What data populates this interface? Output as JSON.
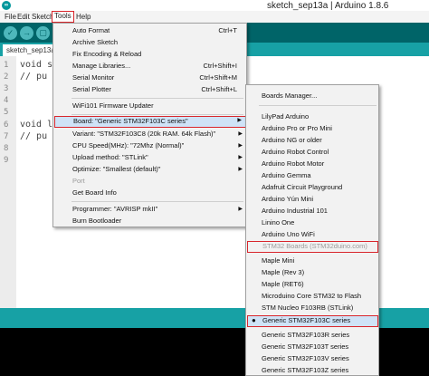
{
  "window": {
    "title": "sketch_sep13a | Arduino 1.8.6",
    "icon_text": "∞"
  },
  "menubar": [
    "File",
    "Edit",
    "Sketch",
    "Tools",
    "Help"
  ],
  "toolbar": {
    "buttons": [
      "✓",
      "→",
      "▢",
      "↑",
      "↓"
    ]
  },
  "tab": {
    "label": "sketch_sep13a"
  },
  "editor": {
    "lines": [
      {
        "num": "1",
        "text": "void se"
      },
      {
        "num": "2",
        "text": "  // pu"
      },
      {
        "num": "3",
        "text": ""
      },
      {
        "num": "4",
        "text": ""
      },
      {
        "num": "5",
        "text": ""
      },
      {
        "num": "6",
        "text": "void lo"
      },
      {
        "num": "7",
        "text": "  // pu"
      },
      {
        "num": "8",
        "text": ""
      },
      {
        "num": "9",
        "text": ""
      }
    ]
  },
  "tools_menu": {
    "items": [
      {
        "label": "Auto Format",
        "shortcut": "Ctrl+T"
      },
      {
        "label": "Archive Sketch",
        "shortcut": ""
      },
      {
        "label": "Fix Encoding & Reload",
        "shortcut": ""
      },
      {
        "label": "Manage Libraries...",
        "shortcut": "Ctrl+Shift+I"
      },
      {
        "label": "Serial Monitor",
        "shortcut": "Ctrl+Shift+M"
      },
      {
        "label": "Serial Plotter",
        "shortcut": "Ctrl+Shift+L"
      },
      {
        "label": "WiFi101 Firmware Updater",
        "shortcut": ""
      },
      {
        "label": "Board: \"Generic STM32F103C series\"",
        "shortcut": ""
      },
      {
        "label": "Variant: \"STM32F103C8 (20k RAM. 64k Flash)\"",
        "shortcut": ""
      },
      {
        "label": "CPU Speed(MHz): \"72Mhz (Normal)\"",
        "shortcut": ""
      },
      {
        "label": "Upload method: \"STLink\"",
        "shortcut": ""
      },
      {
        "label": "Optimize: \"Smallest (default)\"",
        "shortcut": ""
      },
      {
        "label": "Port",
        "shortcut": ""
      },
      {
        "label": "Get Board Info",
        "shortcut": ""
      },
      {
        "label": "Programmer: \"AVRISP mkII\"",
        "shortcut": ""
      },
      {
        "label": "Burn Bootloader",
        "shortcut": ""
      }
    ],
    "submenu_arrow": "▶"
  },
  "boards_menu": {
    "manager": "Boards Manager...",
    "items": [
      "LilyPad Arduino",
      "Arduino Pro or Pro Mini",
      "Arduino NG or older",
      "Arduino Robot Control",
      "Arduino Robot Motor",
      "Arduino Gemma",
      "Adafruit Circuit Playground",
      "Arduino Yún Mini",
      "Arduino Industrial 101",
      "Linino One",
      "Arduino Uno WiFi"
    ],
    "section_header": "STM32 Boards (STM32duino.com)",
    "stm_items": [
      "Maple Mini",
      "Maple (Rev 3)",
      "Maple (RET6)",
      "Microduino Core STM32 to Flash",
      "STM Nucleo F103RB (STLink)",
      "Generic STM32F103C series",
      "Generic STM32F103R series",
      "Generic STM32F103T series",
      "Generic STM32F103V series",
      "Generic STM32F103Z series"
    ],
    "selected_bullet": "●"
  },
  "colors": {
    "accent": "#00979c",
    "toolbar": "#006468",
    "highlight_box": "#d8262c",
    "selection": "#cfe3f7"
  }
}
